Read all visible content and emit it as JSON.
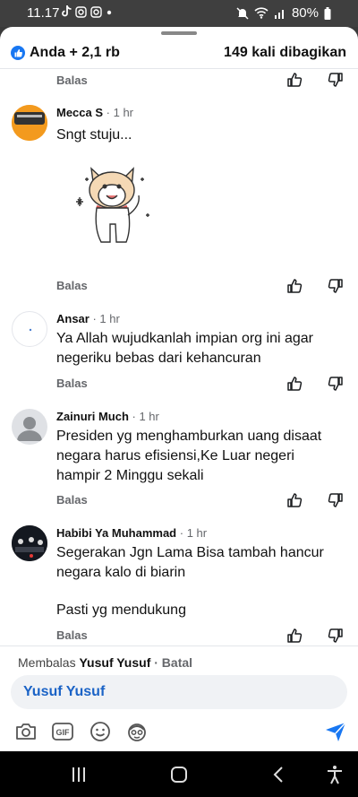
{
  "status": {
    "time": "11.17",
    "battery": "80%"
  },
  "header": {
    "likes": "Anda + 2,1 rb",
    "shares": "149 kali dibagikan"
  },
  "actions": {
    "reply": "Balas"
  },
  "comments": [
    {
      "author": "Mecca S",
      "time": "· 1 hr",
      "text": "Sngt stuju..."
    },
    {
      "author": "Ansar",
      "time": "· 1 hr",
      "text": "Ya Allah wujudkanlah impian org ini agar negeriku bebas dari kehancuran"
    },
    {
      "author": "Zainuri Much",
      "time": "· 1 hr",
      "text": "Presiden yg menghamburkan uang disaat negara harus efisiensi,Ke Luar negeri hampir 2 Minggu sekali"
    },
    {
      "author": "Habibi Ya Muhammad",
      "time": "· 1 hr",
      "text": "Segerakan Jgn Lama Bisa tambah hancur negara kalo di biarin",
      "text2": "Pasti yg mendukung"
    }
  ],
  "reply_bar": {
    "prefix": "Membalas",
    "target": "Yusuf Yusuf",
    "cancel": "· Batal",
    "input_value": "Yusuf Yusuf"
  },
  "colors": {
    "accent": "#1877f2",
    "mention": "#1b63c6"
  },
  "icons": [
    "tiktok-icon",
    "instagram-icon",
    "mute-icon",
    "wifi-icon",
    "signal-icon",
    "battery-icon",
    "like-icon",
    "dislike-icon",
    "camera-icon",
    "gif-icon",
    "emoji-icon",
    "avatar-sticker-icon",
    "send-icon"
  ]
}
